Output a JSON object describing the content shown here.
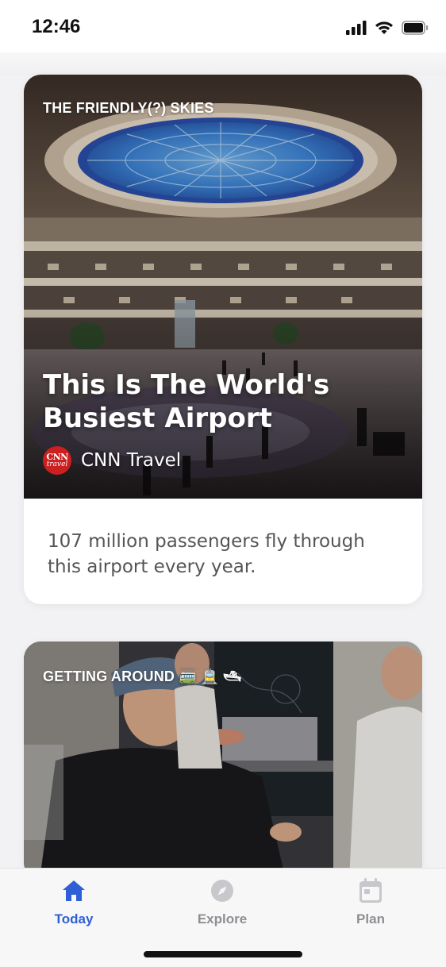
{
  "status_bar": {
    "time": "12:46",
    "icons": [
      "signal-icon",
      "wifi-icon",
      "battery-icon"
    ]
  },
  "cards": [
    {
      "category": "THE FRIENDLY(?) SKIES",
      "title": "This Is The World's Busiest Airport",
      "source": {
        "name": "CNN Travel",
        "logo_text_top": "CNN",
        "logo_text_bottom": "travel",
        "logo_color": "#cc1f1f"
      },
      "summary": "107 million passengers fly through this airport every year.",
      "image": "airport-atrium-photo"
    },
    {
      "category": "GETTING AROUND 🚎 🚊 🛥",
      "image": "cooking-class-photo"
    }
  ],
  "tab_bar": {
    "tabs": [
      {
        "label": "Today",
        "icon": "home-icon",
        "active": true
      },
      {
        "label": "Explore",
        "icon": "compass-icon",
        "active": false
      },
      {
        "label": "Plan",
        "icon": "calendar-icon",
        "active": false
      }
    ]
  },
  "colors": {
    "accent": "#2f5fd6",
    "inactive": "#8e8e93",
    "background": "#f2f2f4"
  }
}
